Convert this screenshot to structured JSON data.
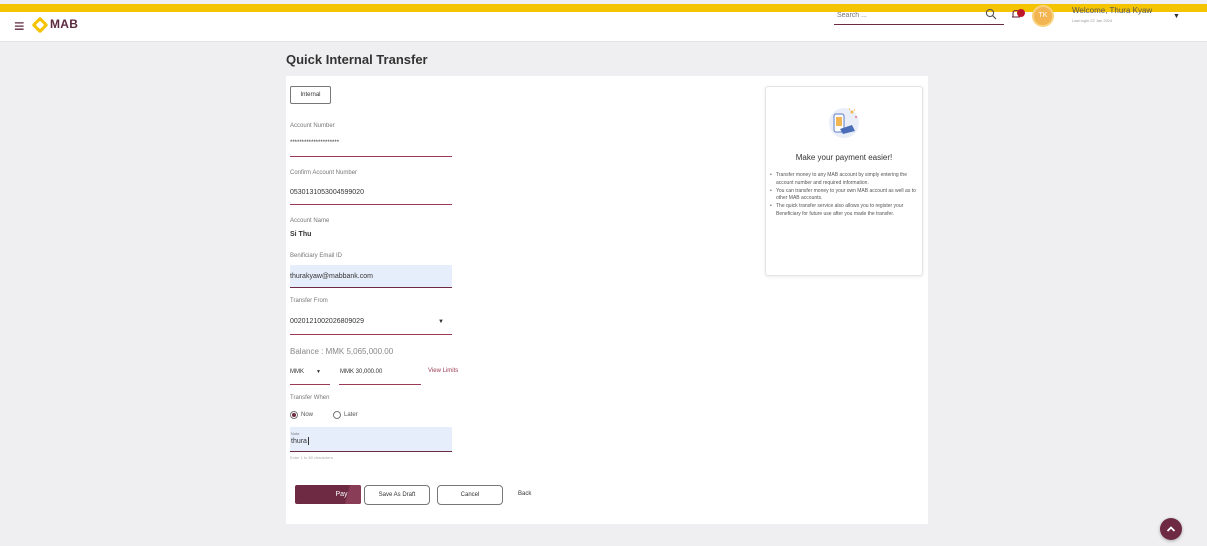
{
  "header": {
    "logo_text": "MAB",
    "search_placeholder": "Search ...",
    "avatar_initials": "TK",
    "welcome": "Welcome, Thura Kyaw",
    "last_login": "Last login 22 Jan 2024"
  },
  "page": {
    "title": "Quick Internal Transfer"
  },
  "form": {
    "transfer_type": "Internal",
    "account_number": {
      "label": "Account Number",
      "value": "*********************"
    },
    "confirm_account_number": {
      "label": "Confirm Account Number",
      "value": "0530131053004599020"
    },
    "account_name": {
      "label": "Account Name",
      "value": "Si Thu"
    },
    "beneficiary_email": {
      "label": "Benificiary Email ID",
      "value": "thurakyaw@mabbank.com"
    },
    "transfer_from": {
      "label": "Transfer From",
      "value": "0020121002026809029"
    },
    "balance": "Balance : MMK 5,065,000.00",
    "currency": "MMK",
    "amount": "MMK 30,000.00",
    "view_limits": "View Limits",
    "transfer_when": {
      "label": "Transfer When",
      "options": [
        "Now",
        "Later"
      ],
      "selected": "Now"
    },
    "note": {
      "label": "Note",
      "value": "thura",
      "hint": "Enter 1 to 80 characters."
    }
  },
  "actions": {
    "pay": "Pay",
    "save_draft": "Save As Draft",
    "cancel": "Cancel",
    "back": "Back"
  },
  "info_panel": {
    "title": "Make your payment easier!",
    "items": [
      "Transfer money to any MAB account by simply entering the account number and required information.",
      "You can transfer money to your own MAB account as well as to other MAB accounts.",
      "The quick transfer service also allows you to register your Beneficiary for future use after you made the transfer."
    ]
  },
  "colors": {
    "brand_primary": "#6d2a42",
    "brand_accent": "#f5c400",
    "input_fill": "#e7eefb"
  }
}
